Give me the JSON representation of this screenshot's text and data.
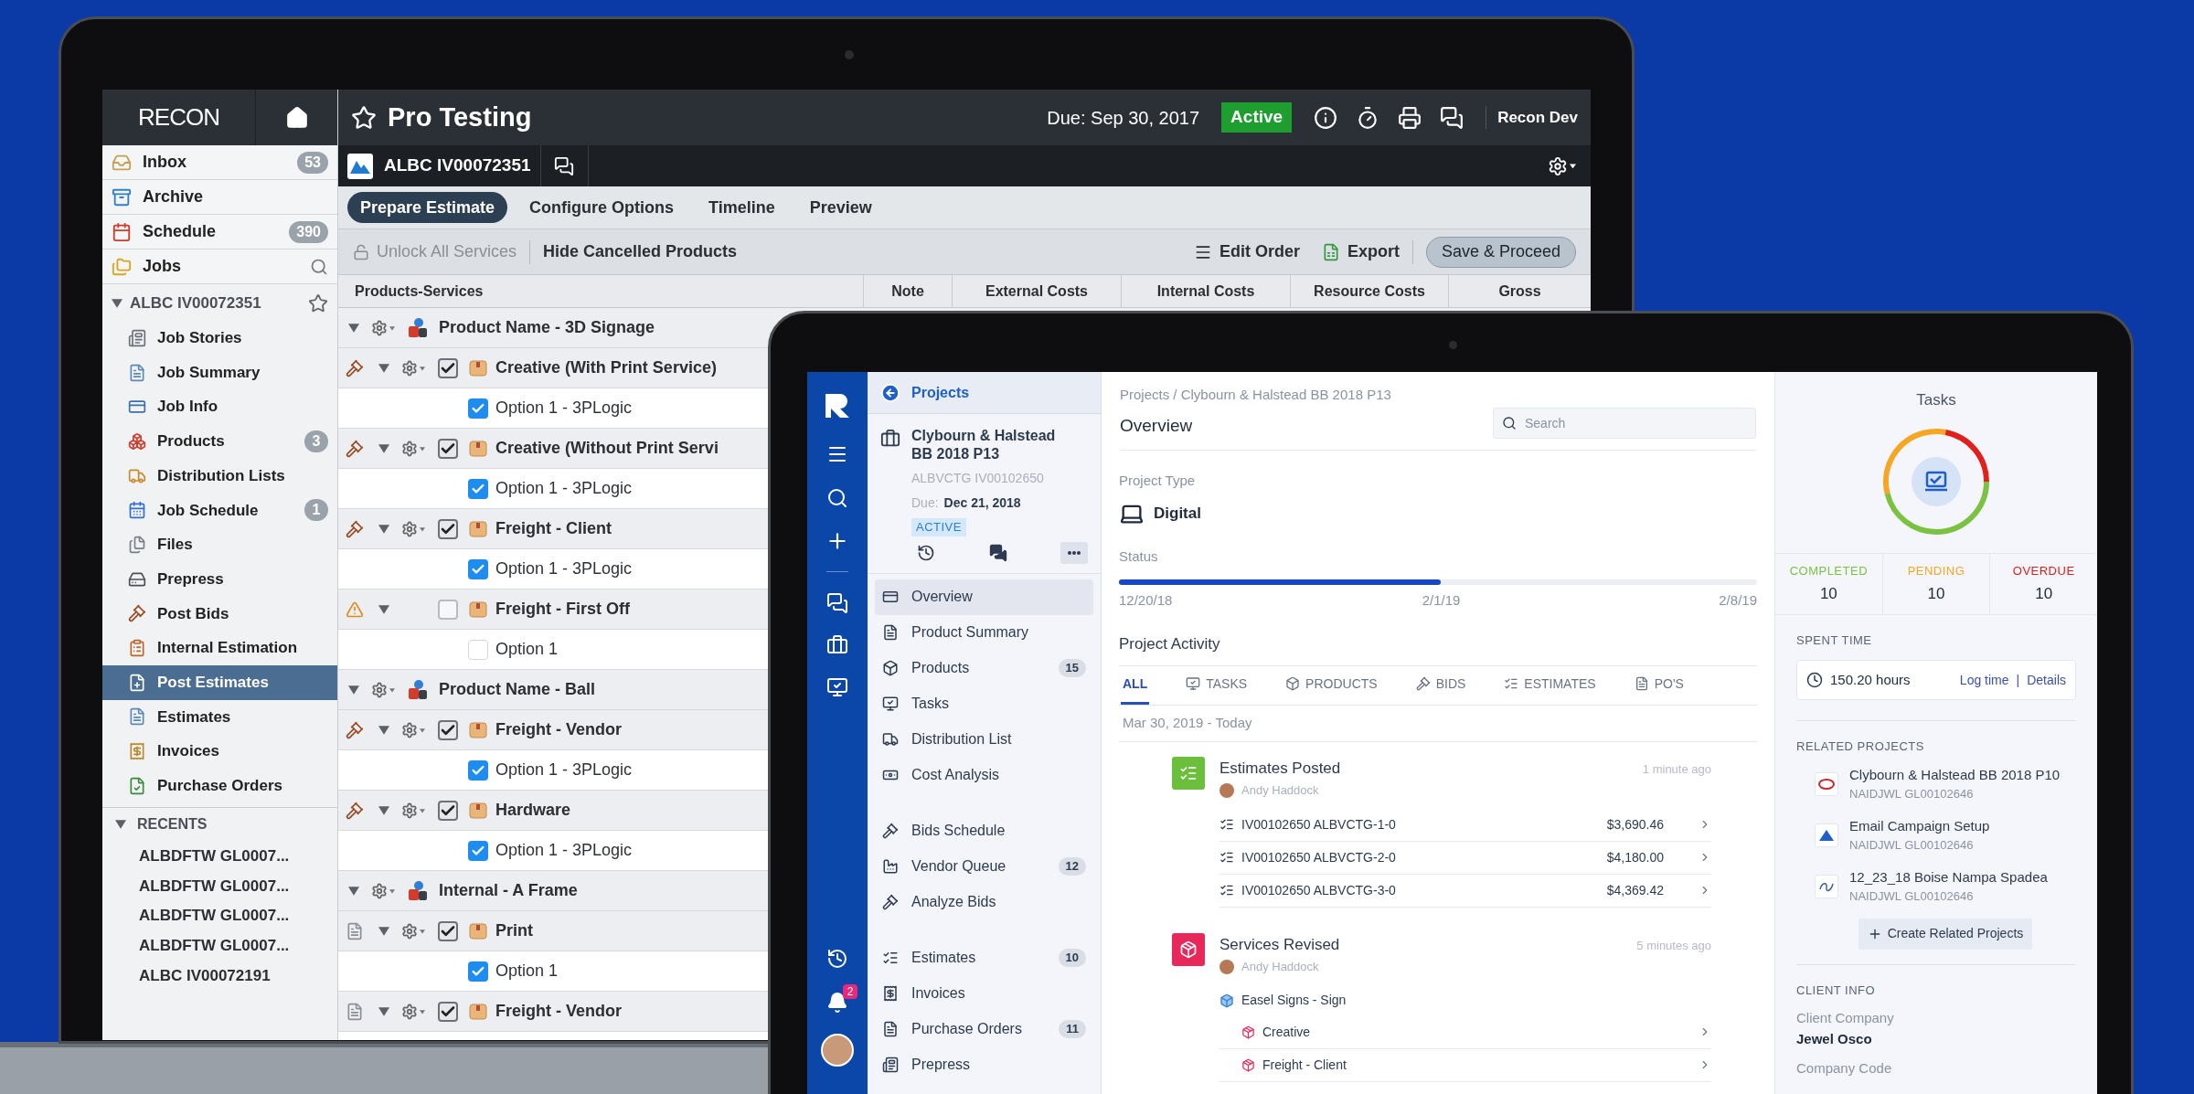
{
  "left_app": {
    "logo": "RECON",
    "nav": [
      {
        "label": "Inbox",
        "count": "53",
        "selected": false
      },
      {
        "label": "Archive",
        "selected": false
      },
      {
        "label": "Schedule",
        "count": "390",
        "selected": false
      },
      {
        "label": "Jobs",
        "selected": false
      }
    ],
    "job": {
      "title": "ALBC IV00072351",
      "expanded": true,
      "items": [
        {
          "label": "Job Stories",
          "selected": false
        },
        {
          "label": "Job Summary",
          "selected": false
        },
        {
          "label": "Job Info",
          "selected": false
        },
        {
          "label": "Products",
          "count": "3",
          "selected": false
        },
        {
          "label": "Distribution Lists",
          "selected": false
        },
        {
          "label": "Job Schedule",
          "count": "1",
          "selected": false
        },
        {
          "label": "Files",
          "selected": false
        },
        {
          "label": "Prepress",
          "selected": false
        },
        {
          "label": "Post Bids",
          "selected": false
        },
        {
          "label": "Internal Estimation",
          "selected": false
        },
        {
          "label": "Post Estimates",
          "selected": true
        },
        {
          "label": "Estimates",
          "selected": false
        },
        {
          "label": "Invoices",
          "selected": false
        },
        {
          "label": "Purchase Orders",
          "selected": false
        }
      ]
    },
    "recents": {
      "title": "RECENTS",
      "expanded": true,
      "items": [
        {
          "label": "ALBDFTW GL0007...",
          "selected": false
        },
        {
          "label": "ALBDFTW GL0007...",
          "selected": false
        },
        {
          "label": "ALBDFTW GL0007...",
          "selected": false
        },
        {
          "label": "ALBDFTW GL0007...",
          "selected": false
        },
        {
          "label": "ALBC IV00072191",
          "selected": false
        }
      ]
    },
    "header": {
      "title": "Pro Testing",
      "due": "Due: Sep 30, 2017",
      "status": "Active",
      "user": "Recon Dev"
    },
    "job_bar": {
      "title": "ALBC IV00072351"
    },
    "tabs": [
      {
        "label": "Prepare Estimate",
        "selected": true
      },
      {
        "label": "Configure Options",
        "selected": false
      },
      {
        "label": "Timeline",
        "selected": false
      },
      {
        "label": "Preview",
        "selected": false
      }
    ],
    "toolbar": {
      "unlock": {
        "label": "Unlock All Services",
        "disabled": true
      },
      "hide": "Hide Cancelled Products",
      "edit_order": "Edit Order",
      "export": "Export",
      "save": "Save & Proceed"
    },
    "columns": [
      "Products-Services",
      "Note",
      "External Costs",
      "Internal Costs",
      "Resource Costs",
      "Gross"
    ],
    "rows": [
      {
        "kind": "product",
        "label": "Product Name - 3D Signage",
        "expanded": true
      },
      {
        "kind": "service",
        "label": "Creative (With Print Service)",
        "status": {
          "kind": "bid"
        },
        "gear": true,
        "checked": true,
        "expanded": true
      },
      {
        "kind": "option",
        "label": "Option 1 - 3PLogic",
        "checked": true
      },
      {
        "kind": "service",
        "label": "Creative (Without Print Servi",
        "status": {
          "kind": "bid"
        },
        "gear": true,
        "checked": true,
        "expanded": true
      },
      {
        "kind": "option",
        "label": "Option 1 - 3PLogic",
        "checked": true
      },
      {
        "kind": "service",
        "label": "Freight - Client",
        "status": {
          "kind": "bid"
        },
        "gear": true,
        "checked": true,
        "expanded": true
      },
      {
        "kind": "option",
        "label": "Option 1 - 3PLogic",
        "checked": true
      },
      {
        "kind": "service",
        "label": "Freight - First Off",
        "status": {
          "kind": "warning"
        },
        "gear": false,
        "checked": false,
        "expanded": true
      },
      {
        "kind": "option",
        "label": "Option 1",
        "checked": false
      },
      {
        "kind": "product",
        "label": "Product Name - Ball",
        "expanded": true
      },
      {
        "kind": "service",
        "label": "Freight - Vendor",
        "status": {
          "kind": "bid"
        },
        "gear": true,
        "checked": true,
        "expanded": true
      },
      {
        "kind": "option",
        "label": "Option 1 - 3PLogic",
        "checked": true
      },
      {
        "kind": "service",
        "label": "Hardware",
        "status": {
          "kind": "bid"
        },
        "gear": true,
        "checked": true,
        "expanded": true
      },
      {
        "kind": "option",
        "label": "Option 1 - 3PLogic",
        "checked": true
      },
      {
        "kind": "product",
        "label": "Internal - A Frame",
        "expanded": true
      },
      {
        "kind": "service",
        "label": "Print",
        "status": {
          "kind": "file"
        },
        "gear": true,
        "checked": true,
        "expanded": true
      },
      {
        "kind": "option",
        "label": "Option 1",
        "checked": true
      },
      {
        "kind": "service",
        "label": "Freight - Vendor",
        "status": {
          "kind": "file"
        },
        "gear": true,
        "checked": true,
        "expanded": true
      }
    ]
  },
  "right_app": {
    "notifications": "2",
    "back": "Projects",
    "project": {
      "name": "Clybourn & Halstead BB 2018 P13",
      "code": "ALBVCTG IV00102650",
      "due_label": "Due:",
      "due": "Dec 21, 2018",
      "status": "ACTIVE"
    },
    "nav_groups": [
      [
        {
          "label": "Overview",
          "selected": true
        },
        {
          "label": "Product Summary",
          "selected": false
        },
        {
          "label": "Products",
          "count": "15",
          "selected": false
        },
        {
          "label": "Tasks",
          "selected": false
        },
        {
          "label": "Distribution List",
          "selected": false
        },
        {
          "label": "Cost Analysis",
          "selected": false
        }
      ],
      [
        {
          "label": "Bids Schedule",
          "selected": false
        },
        {
          "label": "Vendor Queue",
          "count": "12",
          "selected": false
        },
        {
          "label": "Analyze Bids",
          "selected": false
        }
      ],
      [
        {
          "label": "Estimates",
          "count": "10",
          "selected": false
        },
        {
          "label": "Invoices",
          "selected": false
        },
        {
          "label": "Purchase Orders",
          "count": "11",
          "selected": false
        },
        {
          "label": "Prepress",
          "selected": false
        }
      ]
    ],
    "breadcrumb": "Projects / Clybourn & Halstead BB 2018 P13",
    "title": "Overview",
    "search": {
      "placeholder": "Search"
    },
    "project_type": {
      "label": "Project Type",
      "value": "Digital"
    },
    "status": {
      "label": "Status",
      "level": 0.505,
      "start": "12/20/18",
      "mid": "2/1/19",
      "end": "2/8/19"
    },
    "activity": {
      "title": "Project Activity",
      "tabs": [
        {
          "label": "ALL",
          "selected": true
        },
        {
          "label": "TASKS",
          "selected": false
        },
        {
          "label": "PRODUCTS",
          "selected": false
        },
        {
          "label": "BIDS",
          "selected": false
        },
        {
          "label": "ESTIMATES",
          "selected": false
        },
        {
          "label": "PO'S",
          "selected": false
        }
      ],
      "date": "Mar 30, 2019 - Today",
      "events": [
        {
          "kind": "estimates",
          "title": "Estimates Posted",
          "user": "Andy Haddock",
          "time": "1 minute ago",
          "color": "#6cbf3c",
          "lines": [
            {
              "label": "IV00102650 ALBVCTG-1-0",
              "amount": "$3,690.46"
            },
            {
              "label": "IV00102650 ALBVCTG-2-0",
              "amount": "$4,180.00"
            },
            {
              "label": "IV00102650 ALBVCTG-3-0",
              "amount": "$4,369.42"
            }
          ]
        },
        {
          "kind": "services",
          "title": "Services Revised",
          "user": "Andy Haddock",
          "time": "5 minutes ago",
          "color": "#e8285a",
          "product": "Easel Signs - Sign",
          "lines": [
            {
              "label": "Creative"
            },
            {
              "label": "Freight - Client"
            }
          ]
        }
      ]
    },
    "tasks": {
      "title": "Tasks",
      "stats": [
        {
          "label": "COMPLETED",
          "value": "10",
          "color": "#7cc242"
        },
        {
          "label": "PENDING",
          "value": "10",
          "color": "#f5a623"
        },
        {
          "label": "OVERDUE",
          "value": "10",
          "color": "#e0201c"
        }
      ]
    },
    "spent_time": {
      "title": "SPENT TIME",
      "hours": "150.20 hours",
      "log": "Log time",
      "separator": "|",
      "details": "Details"
    },
    "related": {
      "title": "RELATED PROJECTS",
      "items": [
        {
          "name": "Clybourn & Halstead BB 2018 P10",
          "code": "NAIDJWL GL00102646"
        },
        {
          "name": "Email Campaign Setup",
          "code": "NAIDJWL GL00102646"
        },
        {
          "name": "12_23_18 Boise Nampa Spadea",
          "code": "NAIDJWL GL00102646"
        }
      ],
      "create": "Create Related Projects"
    },
    "client": {
      "title": "CLIENT INFO",
      "fields": [
        {
          "label": "Client Company",
          "value": "Jewel Osco"
        },
        {
          "label": "Company Code"
        }
      ]
    }
  }
}
